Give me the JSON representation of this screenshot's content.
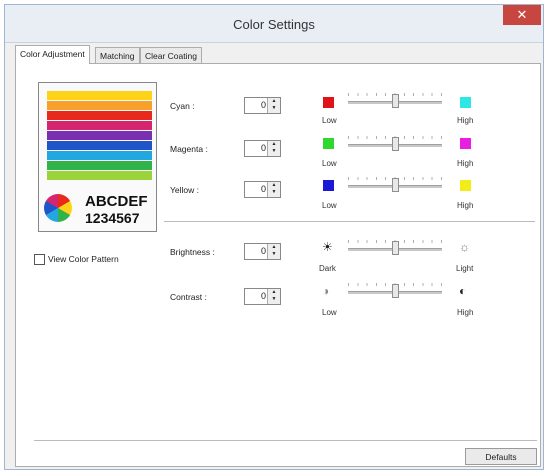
{
  "window": {
    "title": "Color Settings",
    "close_icon": "close-icon"
  },
  "tabs": [
    {
      "label": "Color Adjustment",
      "active": true
    },
    {
      "label": "Matching",
      "active": false
    },
    {
      "label": "Clear Coating",
      "active": false
    }
  ],
  "sample": {
    "text_line1": "ABCDEF",
    "text_line2": "1234567"
  },
  "view_pattern": {
    "label": "View Color Pattern",
    "checked": false
  },
  "adjustments": [
    {
      "label": "Cyan :",
      "value": "0",
      "low": "Low",
      "high": "High",
      "low_color": "#e0131a",
      "high_color": "#2ee6e6",
      "level": 0.5
    },
    {
      "label": "Magenta :",
      "value": "0",
      "low": "Low",
      "high": "High",
      "low_color": "#2ed82e",
      "high_color": "#e81ee0",
      "level": 0.5
    },
    {
      "label": "Yellow :",
      "value": "0",
      "low": "Low",
      "high": "High",
      "low_color": "#1a1ad6",
      "high_color": "#f2ec18",
      "level": 0.5
    }
  ],
  "brightness": {
    "label": "Brightness :",
    "value": "0",
    "low": "Dark",
    "high": "Light",
    "low_icon": "sun-dark-icon",
    "high_icon": "sun-light-icon",
    "level": 0.5
  },
  "contrast": {
    "label": "Contrast :",
    "value": "0",
    "low": "Low",
    "high": "High",
    "low_icon": "contrast-low-icon",
    "high_icon": "contrast-high-icon",
    "level": 0.5
  },
  "buttons": {
    "defaults": "Defaults"
  }
}
